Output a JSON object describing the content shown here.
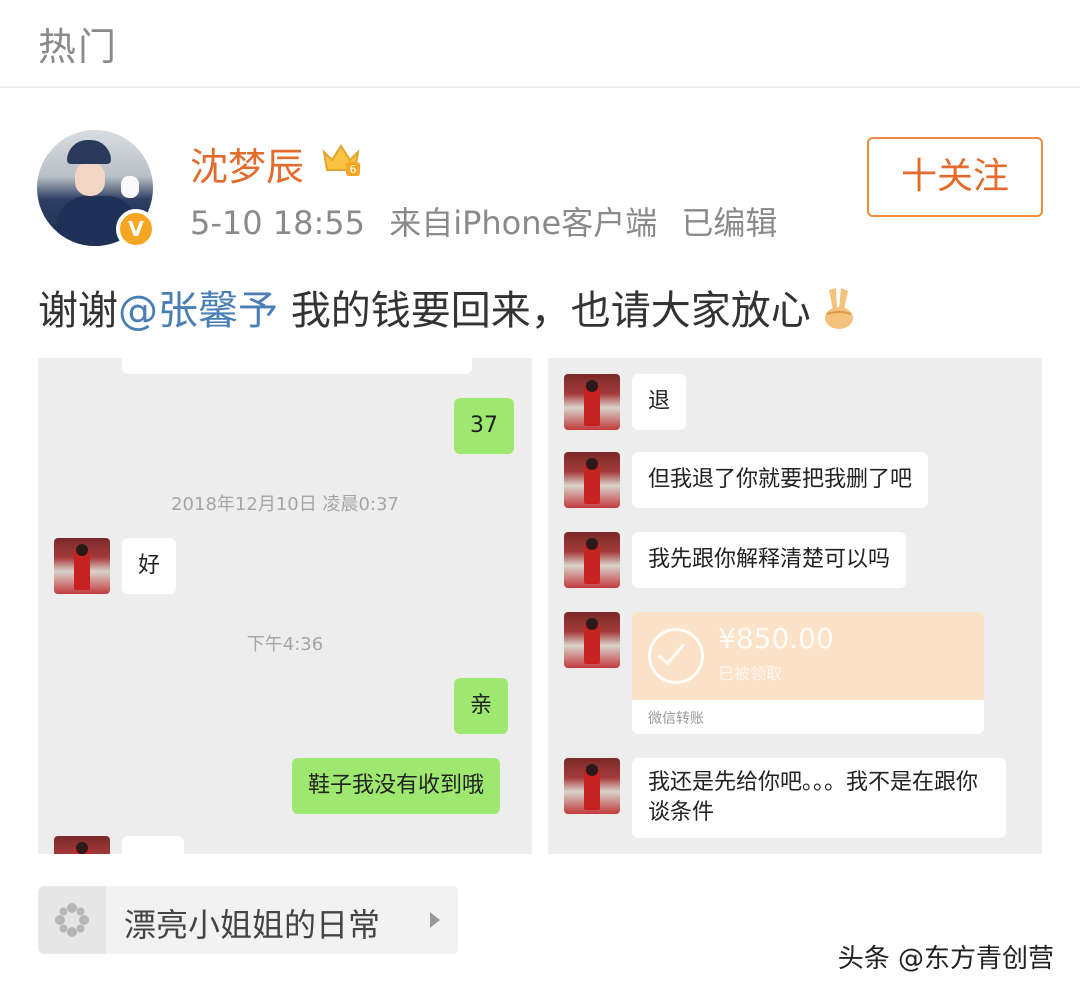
{
  "header": {
    "title": "热门"
  },
  "post": {
    "username": "沈梦辰",
    "crown_icon": "crown-icon",
    "verified_icon": "verified-v-icon",
    "time": "5-10 18:55",
    "source": "来自iPhone客户端",
    "edited": "已编辑",
    "follow_label": "十关注",
    "text_before": "谢谢",
    "mention": "@张馨予",
    "text_after": " 我的钱要回来，也请大家放心",
    "emoji": "victory-hand-icon"
  },
  "screenshot_left": {
    "bubble_37": "37",
    "timestamp_1": "2018年12月10日 凌晨0:37",
    "bubble_hao": "好",
    "timestamp_2": "下午4:36",
    "bubble_qin": "亲",
    "bubble_shoes": "鞋子我没有收到哦"
  },
  "screenshot_right": {
    "bubble_tui": "退",
    "bubble_2": "但我退了你就要把我删了吧",
    "bubble_3": "我先跟你解释清楚可以吗",
    "transfer_amount": "¥850.00",
    "transfer_status": "已被领取",
    "transfer_footer": "微信转账",
    "bubble_5": "我还是先给你吧。。。我不是在跟你谈条件"
  },
  "topic": {
    "label": "漂亮小姐姐的日常",
    "icon": "topic-flower-icon"
  },
  "watermark": "头条 @东方青创营",
  "colors": {
    "username": "#e36b2c",
    "mention": "#4a7fb5",
    "follow_border": "#f08a3c",
    "wechat_green": "#9fe870"
  }
}
